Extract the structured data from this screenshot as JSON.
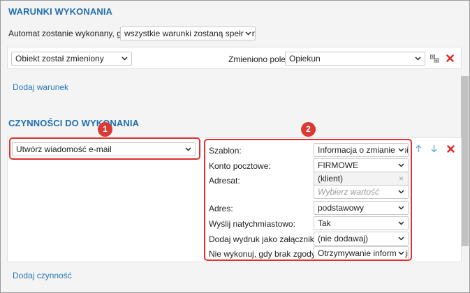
{
  "conditions": {
    "title": "WARUNKI WYKONANIA",
    "automat_label": "Automat zostanie wykonany, gdy",
    "automat_value": "wszystkie warunki zostaną spełnione",
    "object_value": "Obiekt został zmieniony",
    "field_label": "Zmieniono pole:",
    "field_value": "Opiekun",
    "add_link": "Dodaj warunek"
  },
  "actions": {
    "title": "CZYNNOŚCI DO WYKONANIA",
    "action_value": "Utwórz wiadomość e-mail",
    "add_link": "Dodaj czynność",
    "fields": {
      "template_label": "Szablon:",
      "template_value": "Informacja o zmianie opiekuna",
      "account_label": "Konto pocztowe:",
      "account_value": "FIRMOWE",
      "recipient_label": "Adresat:",
      "recipient_value": "(klient)",
      "recipient_placeholder": "Wybierz wartość",
      "address_label": "Adres:",
      "address_value": "podstawowy",
      "send_label": "Wyślij natychmiastowo:",
      "send_value": "Tak",
      "print_label": "Dodaj wydruk jako załącznik:",
      "print_value": "(nie dodawaj)",
      "consent_label": "Nie wykonuj, gdy brak zgody:",
      "consent_value": "Otrzymywanie informacji handlowych"
    }
  },
  "badges": [
    "1",
    "2"
  ],
  "colors": {
    "title": "#1f6fb0",
    "link": "#2a78b9",
    "highlight": "#e03030",
    "delete": "#e2262b",
    "arrow": "#6aaad8"
  },
  "icons": [
    "chevron-down-icon",
    "filter-settings-icon",
    "delete-icon",
    "arrow-up-icon",
    "arrow-down-icon",
    "clear-icon"
  ]
}
